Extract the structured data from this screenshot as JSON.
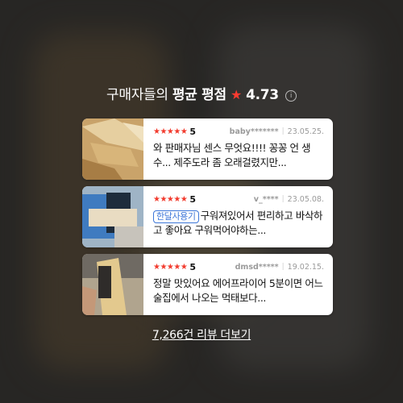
{
  "header": {
    "prefix": "구매자들의",
    "title_bold": "평균 평점",
    "star": "★",
    "rating": "4.73",
    "info_icon": "i"
  },
  "reviews": [
    {
      "stars": "★★★★★",
      "score": "5",
      "author": "baby*******",
      "date": "23.05.25.",
      "tag": "",
      "text": "와 판매자님 센스 무엇요!!!! 꽁꽁 언 생수... 제주도라 좀 오래걸렸지만..."
    },
    {
      "stars": "★★★★★",
      "score": "5",
      "author": "v_****",
      "date": "23.05.08.",
      "tag": "한달사용기",
      "text": "구워져있어서 편리하고 바삭하고 좋아요 구워먹어야하는..."
    },
    {
      "stars": "★★★★★",
      "score": "5",
      "author": "dmsd*****",
      "date": "19.02.15.",
      "tag": "",
      "text": "정말 맛있어요 에어프라이어 5분이면 어느 술집에서 나오는 먹태보다..."
    }
  ],
  "more_link": "7,266건 리뷰 더보기",
  "colors": {
    "accent_star": "#f23b2e",
    "tag_blue": "#3c76d8"
  }
}
